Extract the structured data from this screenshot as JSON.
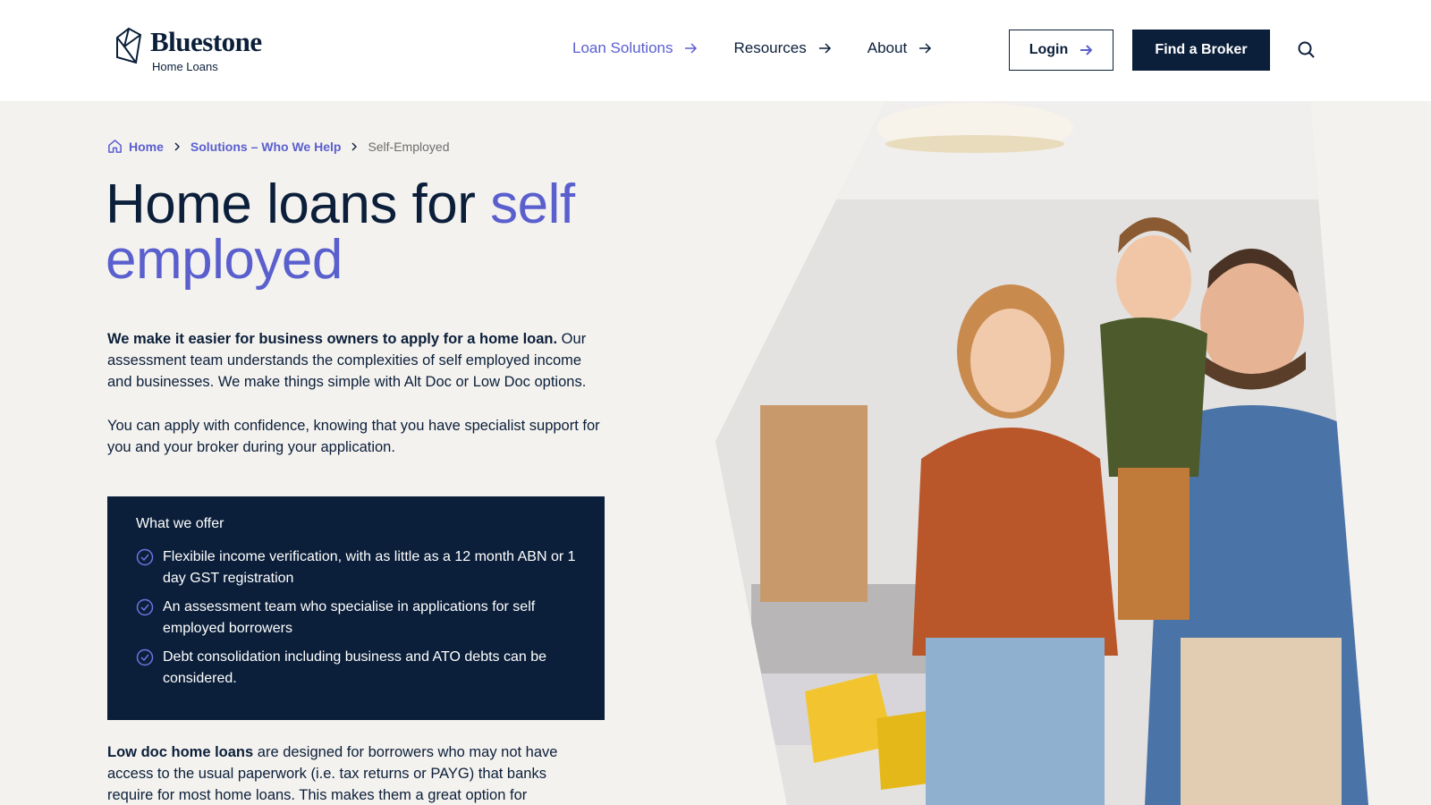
{
  "brand": {
    "name": "Bluestone",
    "tagline": "Home Loans"
  },
  "nav": {
    "items": [
      {
        "label": "Loan Solutions",
        "active": true
      },
      {
        "label": "Resources",
        "active": false
      },
      {
        "label": "About",
        "active": false
      }
    ],
    "login_label": "Login",
    "broker_label": "Find a Broker"
  },
  "breadcrumb": {
    "home": "Home",
    "section": "Solutions – Who We Help",
    "current": "Self-Employed"
  },
  "hero": {
    "title_plain": "Home loans for ",
    "title_accent": "self employed",
    "intro_bold": "We make it easier for business owners to apply for a home loan.",
    "intro_rest": " Our assessment team understands the complexities of self employed income and businesses. We make things simple with Alt Doc or Low Doc options.",
    "intro2": "You can apply with confidence, knowing that you have specialist support for you and your broker during your application."
  },
  "offer": {
    "heading": "What we offer",
    "items": [
      "Flexibile income verification, with as little as a 12 month ABN or 1 day GST registration",
      "An assessment team who specialise in applications for self employed borrowers",
      "Debt consolidation including business and ATO debts can be considered."
    ]
  },
  "lowdoc": {
    "bold": "Low doc home loans",
    "rest": " are designed for borrowers who may not have access to the usual paperwork (i.e. tax returns or PAYG) that banks require for most home loans. This makes them a great option for"
  },
  "colors": {
    "navy": "#0b1f3a",
    "accent": "#5a5fce",
    "page_bg": "#f4f2ef",
    "light_blue": "#a9cdf6"
  }
}
